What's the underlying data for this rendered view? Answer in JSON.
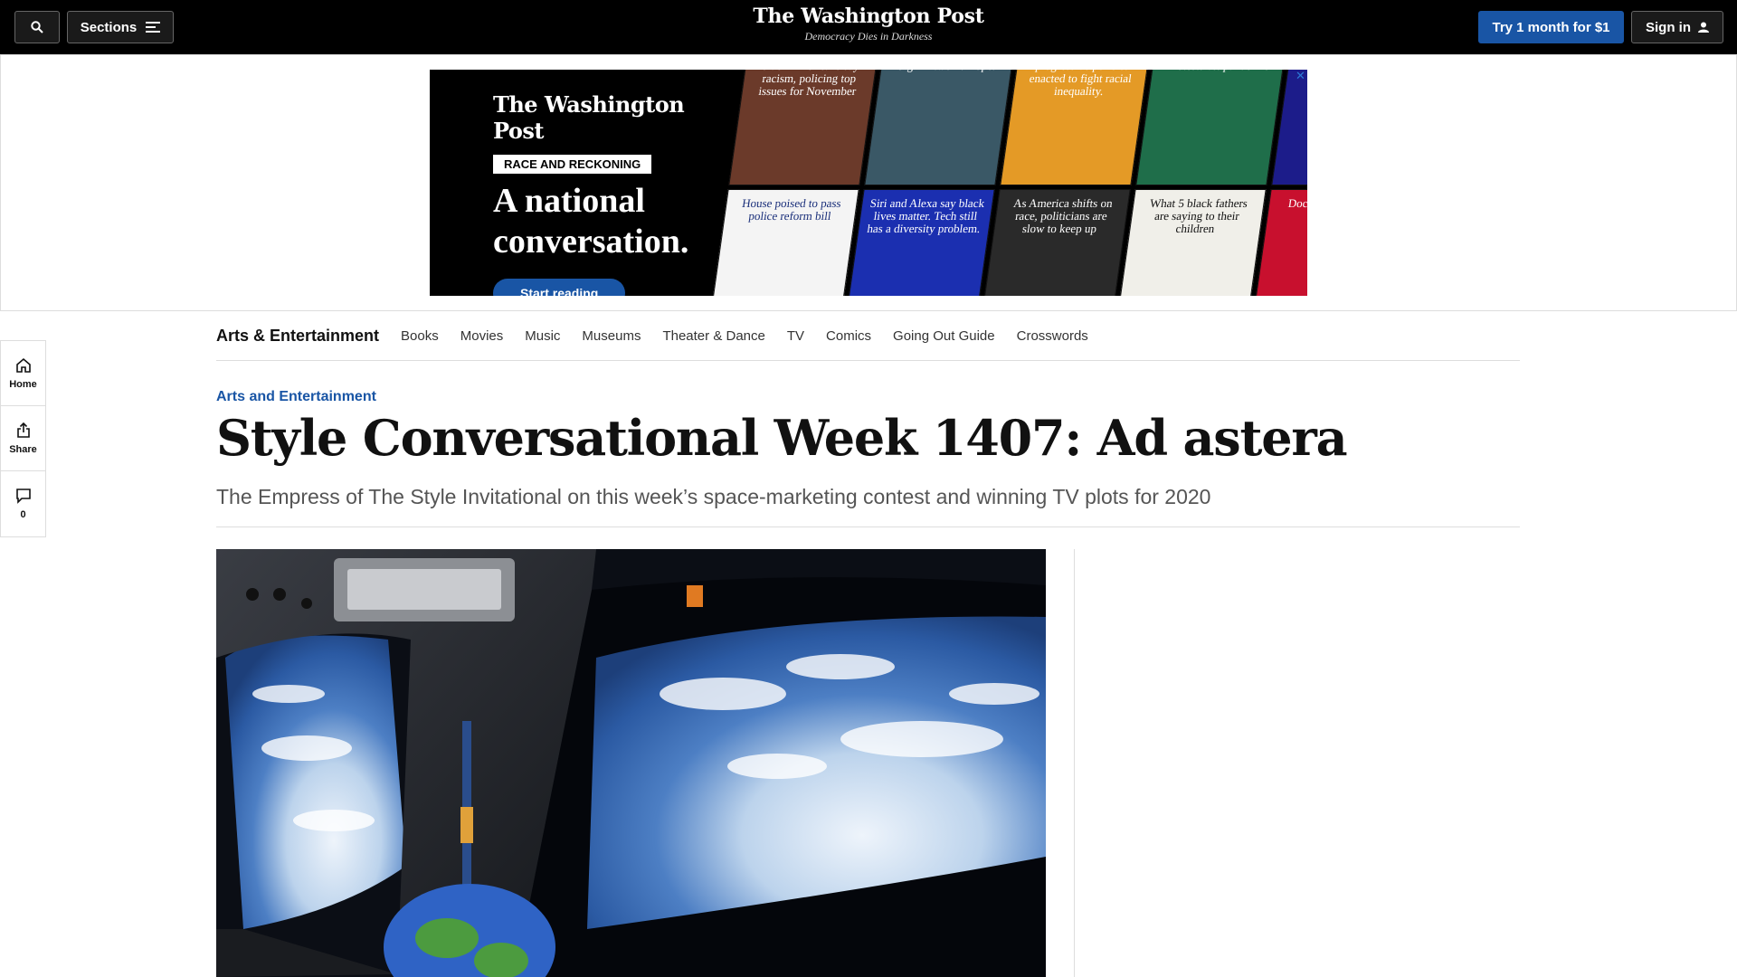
{
  "topbar": {
    "search_icon": "search-icon",
    "sections_label": "Sections",
    "sections_icon": "menu-icon",
    "logo": "The Washington Post",
    "tagline": "Democracy Dies in Darkness",
    "try_label": "Try 1 month for $1",
    "signin_label": "Sign in",
    "signin_icon": "user-icon"
  },
  "ad": {
    "logo": "The Washington Post",
    "tag": "RACE AND RECKONING",
    "headline_line1": "A national",
    "headline_line2": "conversation.",
    "cta": "Start reading",
    "tiles": [
      "black Americans say racism, policing top issues for November",
      "Sign Artwork. Hope.",
      "progressive policies enacted to fight racial inequality.",
      "Protests vs. pandemic",
      "House poised to pass police reform bill",
      "Siri and Alexa say black lives matter. Tech still has a diversity problem.",
      "As America shifts on race, politicians are slow to keep up",
      "What 5 black fathers are saying to their children",
      "Doctors racism in h"
    ]
  },
  "rail": {
    "home_label": "Home",
    "share_label": "Share",
    "comments_count": "0"
  },
  "secnav": {
    "brand": "Arts & Entertainment",
    "items": [
      "Books",
      "Movies",
      "Music",
      "Museums",
      "Theater & Dance",
      "TV",
      "Comics",
      "Going Out Guide",
      "Crosswords"
    ]
  },
  "article": {
    "kicker": "Arts and Entertainment",
    "headline": "Style Conversational Week 1407: Ad astera",
    "dek": "The Empress of The Style Invitational on this week’s space-marketing contest and winning TV plots for 2020"
  },
  "colors": {
    "accent": "#1955a5",
    "topbar_bg": "#000000"
  }
}
